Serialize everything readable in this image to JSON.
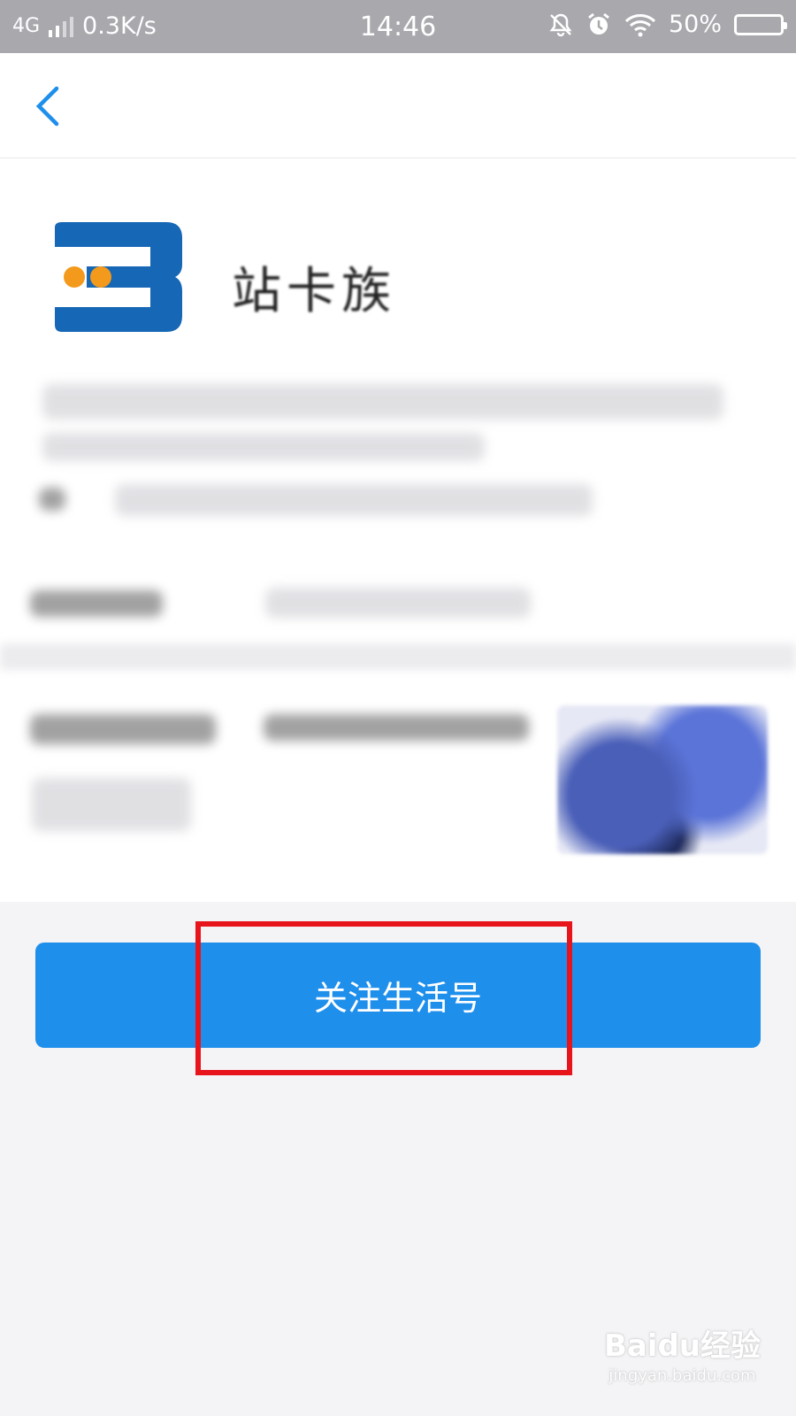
{
  "status_bar": {
    "network": "4G",
    "speed": "0.3K/s",
    "time": "14:46",
    "battery": "50%"
  },
  "nav": {
    "back_icon": "chevron-left-icon"
  },
  "account": {
    "name": "站卡族"
  },
  "follow_button": {
    "label": "关注生活号"
  },
  "watermark": {
    "main": "Baidu经验",
    "sub": "jingyan.baidu.com"
  },
  "colors": {
    "accent": "#1f8fec",
    "highlight": "#e8141c",
    "status_bar": "#a9a8ad"
  }
}
